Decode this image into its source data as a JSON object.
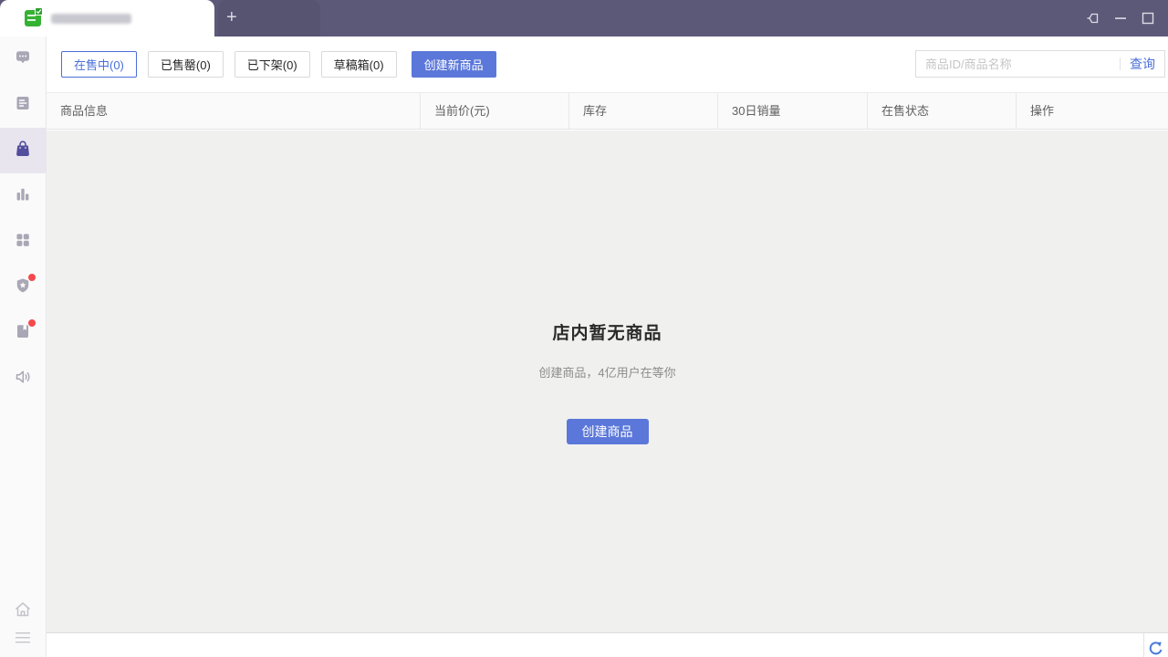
{
  "window": {
    "tab": {
      "favicon": "green-check-favicon",
      "title_redacted": true
    },
    "new_tab_label": "+",
    "controls": {
      "pin": "pin",
      "minimize": "minimize",
      "maximize": "maximize"
    }
  },
  "sidebar": {
    "items": [
      {
        "icon": "chat-icon",
        "active": false,
        "badge": false
      },
      {
        "icon": "document-icon",
        "active": false,
        "badge": false
      },
      {
        "icon": "shopping-bag-icon",
        "active": true,
        "badge": false
      },
      {
        "icon": "bar-chart-icon",
        "active": false,
        "badge": false
      },
      {
        "icon": "grid-icon",
        "active": false,
        "badge": false
      },
      {
        "icon": "shield-star-icon",
        "active": false,
        "badge": true
      },
      {
        "icon": "book-icon",
        "active": false,
        "badge": true
      },
      {
        "icon": "speaker-icon",
        "active": false,
        "badge": false
      }
    ],
    "bottom_items": [
      {
        "icon": "home-icon"
      },
      {
        "icon": "menu-icon"
      }
    ]
  },
  "toolbar": {
    "filters": [
      {
        "label": "在售中(0)",
        "selected": true
      },
      {
        "label": "已售罄(0)",
        "selected": false
      },
      {
        "label": "已下架(0)",
        "selected": false
      },
      {
        "label": "草稿箱(0)",
        "selected": false
      }
    ],
    "create_button": "创建新商品",
    "search": {
      "placeholder": "商品ID/商品名称",
      "submit_label": "查询"
    }
  },
  "table": {
    "columns": [
      "商品信息",
      "当前价(元)",
      "库存",
      "30日销量",
      "在售状态",
      "操作"
    ],
    "rows": []
  },
  "empty_state": {
    "title": "店内暂无商品",
    "subtitle": "创建商品，4亿用户在等你",
    "button": "创建商品"
  },
  "colors": {
    "titlebar": "#5c5978",
    "accent": "#4b6fd9",
    "primary_button": "#5b77d9",
    "sidebar_active_icon": "#534d9e",
    "sidebar_active_bg": "#e8e5ef",
    "notification_badge": "#f5494d",
    "content_bg": "#f0f0ef",
    "favicon_green": "#35b233"
  }
}
